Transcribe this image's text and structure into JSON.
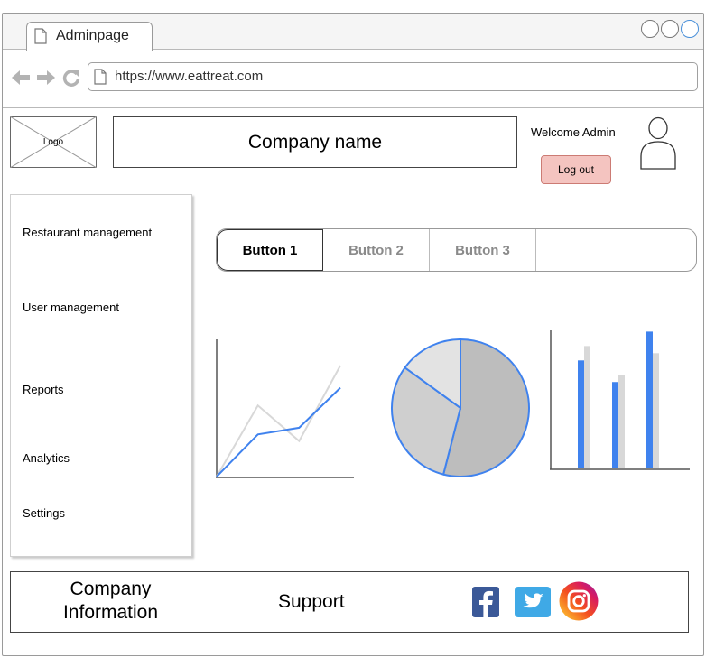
{
  "browser": {
    "tab_title": "Adminpage",
    "url": "https://www.eattreat.com"
  },
  "header": {
    "logo_label": "Logo",
    "company_name": "Company name",
    "welcome_text": "Welcome Admin",
    "logout_label": "Log out"
  },
  "sidebar": {
    "items": [
      {
        "label": "Restaurant management"
      },
      {
        "label": "User management"
      },
      {
        "label": "Reports"
      },
      {
        "label": "Analytics"
      },
      {
        "label": "Settings"
      }
    ]
  },
  "button_group": {
    "buttons": [
      {
        "label": "Button 1",
        "active": true
      },
      {
        "label": "Button 2",
        "active": false
      },
      {
        "label": "Button 3",
        "active": false
      }
    ]
  },
  "colors": {
    "accent_blue": "#3f82ee",
    "light_gray": "#d8d8d8",
    "pie_dark": "#bdbdbd",
    "pie_mid": "#cfcfcf",
    "pie_light": "#e3e3e3",
    "logout_bg": "#f4c4c0"
  },
  "chart_data": [
    {
      "type": "line",
      "x": [
        1,
        2,
        3,
        4
      ],
      "series": [
        {
          "values": [
            0,
            1.9,
            2.2,
            4.0
          ]
        },
        {
          "values": [
            0,
            3.2,
            1.6,
            5.0
          ]
        }
      ],
      "ylim": [
        0,
        6
      ]
    },
    {
      "type": "pie",
      "values": [
        54,
        31,
        15
      ]
    },
    {
      "type": "bar",
      "categories": [
        "1",
        "2",
        "3"
      ],
      "series": [
        {
          "values": [
            75,
            60,
            95
          ]
        },
        {
          "values": [
            85,
            65,
            80
          ]
        }
      ],
      "ylim": [
        0,
        100
      ]
    }
  ],
  "footer": {
    "company_info_line1": "Company",
    "company_info_line2": "Information",
    "support_label": "Support",
    "social_icons": [
      "facebook-icon",
      "twitter-icon",
      "instagram-icon"
    ]
  }
}
